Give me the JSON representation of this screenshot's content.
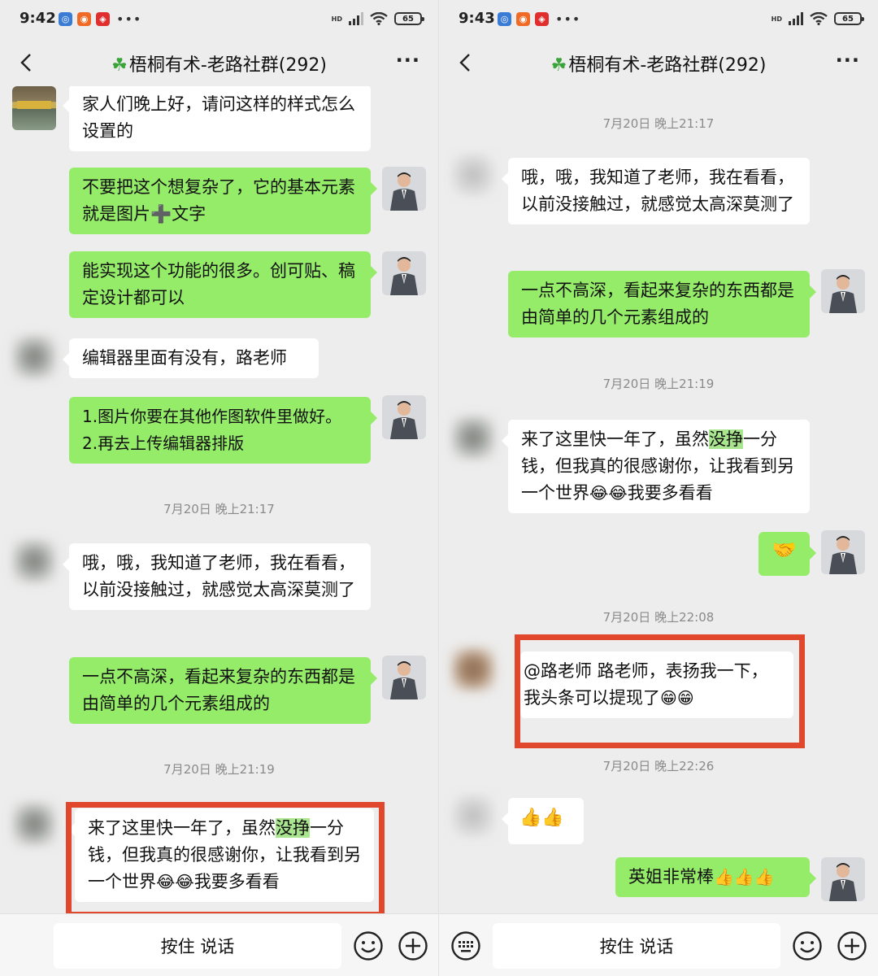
{
  "left": {
    "status": {
      "time": "9:42",
      "battery": "65",
      "hd": "HD"
    },
    "title": "梧桐有术-老路社群(292)",
    "messages": {
      "m1": "家人们晚上好，请问这样的样式怎么设置的",
      "m2a": "不要把这个想复杂了，它的基本元素就是图片",
      "m2b": "文字",
      "m3": "能实现这个功能的很多。创可贴、稿定设计都可以",
      "m4": "编辑器里面有没有，路老师",
      "m5a": "1.图片你要在其他作图软件里做好。",
      "m5b": "2.再去上传编辑器排版",
      "ts1": "7月20日 晚上21:17",
      "m6": "哦，哦，我知道了老师，我在看看，以前没接触过，就感觉太高深莫测了",
      "m7": "一点不高深，看起来复杂的东西都是由简单的几个元素组成的",
      "ts2": "7月20日 晚上21:19",
      "m8a": "来了这里快一年了，虽然",
      "m8hl": "没挣",
      "m8b": "一分钱，但我真的很感谢你，让我看到另一个世界",
      "m8emoji": "😂😂",
      "m8c": "我要多看看"
    },
    "bottom": {
      "voice": "按住 说话"
    }
  },
  "right": {
    "status": {
      "time": "9:43",
      "battery": "65",
      "hd": "HD"
    },
    "title": "梧桐有术-老路社群(292)",
    "messages": {
      "ts1": "7月20日 晚上21:17",
      "m1": "哦，哦，我知道了老师，我在看看，以前没接触过，就感觉太高深莫测了",
      "m2": "一点不高深，看起来复杂的东西都是由简单的几个元素组成的",
      "ts2": "7月20日 晚上21:19",
      "m3a": "来了这里快一年了，虽然",
      "m3hl": "没挣",
      "m3b": "一分钱，但我真的很感谢你，让我看到另一个世界",
      "m3emoji": "😂😂",
      "m3c": "我要多看看",
      "m4": "🤝",
      "ts3": "7月20日 晚上22:08",
      "m5a": "@路老师  路老师，表扬我一下，",
      "m5b": "我头条可以提现了",
      "m5emoji": "😁😁",
      "ts4": "7月20日 晚上22:26",
      "m6": "👍👍",
      "m7": "英姐非常棒",
      "m7emoji": "👍👍👍"
    },
    "bottom": {
      "voice": "按住 说话"
    }
  },
  "icons": {
    "back": "chevron-left-icon",
    "more": "more-icon",
    "keyboard": "keyboard-icon",
    "emoji": "emoji-icon",
    "plus": "plus-icon",
    "plus_glyph": "➕"
  },
  "colors": {
    "chat_bg": "#ededed",
    "self_bubble": "#95ec69",
    "other_bubble": "#ffffff",
    "highlight_box": "#e0472d"
  }
}
